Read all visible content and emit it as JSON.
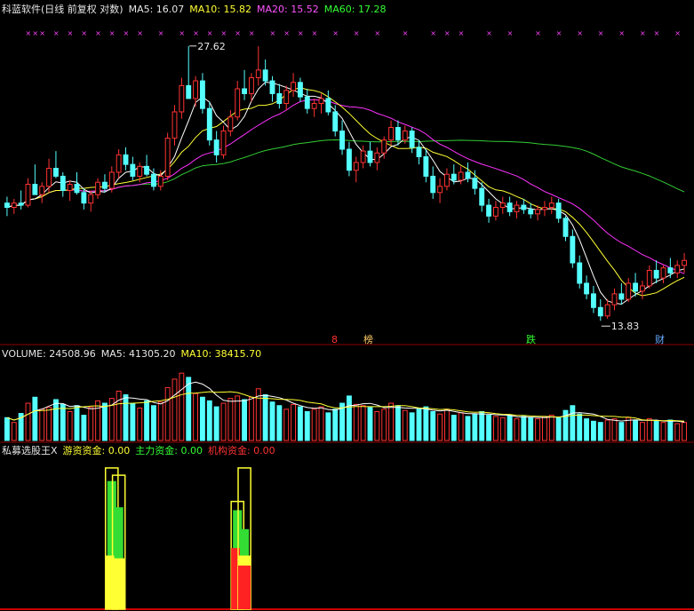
{
  "header_price": {
    "title": "科蓝软件(日线 前复权 对数)",
    "ma5": "MA5: 16.07",
    "ma10": "MA10: 15.82",
    "ma20": "MA20: 15.52",
    "ma60": "MA60: 17.28"
  },
  "header_volume": {
    "vol": "VOLUME: 24508.96",
    "ma5": "MA5: 41305.20",
    "ma10": "MA10: 38415.70"
  },
  "header_indicator": {
    "name": "私募选股王X",
    "youzi": "游资资金: 0.00",
    "zhuli": "主力资金: 0.00",
    "jigou": "机构资金: 0.00"
  },
  "annotations": {
    "high_label": "27.62",
    "low_label": "13.83",
    "tag1": "8",
    "tag2": "榜",
    "tag3": "跌",
    "tag4": "财"
  },
  "colors": {
    "up": "#ff3333",
    "down": "#55ffff",
    "ma5": "#ffffff",
    "ma10": "#ffff33",
    "ma20": "#ff33ff",
    "ma60": "#33cc33",
    "grid": "#8b0000"
  },
  "chart_data": {
    "type": "candlestick",
    "price_range": [
      13.5,
      29.0
    ],
    "candles": [
      [
        18.6,
        18.9,
        18.0,
        18.4
      ],
      [
        18.4,
        18.8,
        18.1,
        18.6
      ],
      [
        18.6,
        19.2,
        18.3,
        18.5
      ],
      [
        18.5,
        19.8,
        18.4,
        19.5
      ],
      [
        19.5,
        20.5,
        19.2,
        19.0
      ],
      [
        19.0,
        19.6,
        18.6,
        19.4
      ],
      [
        19.4,
        20.8,
        19.1,
        20.3
      ],
      [
        20.3,
        21.2,
        19.8,
        19.9
      ],
      [
        19.9,
        20.1,
        18.9,
        19.2
      ],
      [
        19.2,
        19.7,
        18.7,
        19.5
      ],
      [
        19.5,
        20.1,
        19.0,
        19.1
      ],
      [
        19.1,
        19.3,
        18.3,
        18.6
      ],
      [
        18.6,
        19.2,
        18.2,
        19.0
      ],
      [
        19.0,
        19.8,
        18.8,
        19.6
      ],
      [
        19.6,
        20.0,
        19.1,
        19.3
      ],
      [
        19.3,
        20.4,
        19.1,
        20.1
      ],
      [
        20.1,
        21.3,
        19.8,
        21.0
      ],
      [
        21.0,
        21.4,
        20.2,
        20.5
      ],
      [
        20.5,
        20.9,
        19.7,
        19.9
      ],
      [
        19.9,
        20.6,
        19.6,
        20.4
      ],
      [
        20.4,
        21.0,
        19.9,
        20.0
      ],
      [
        20.0,
        20.3,
        19.2,
        19.4
      ],
      [
        19.4,
        20.2,
        19.2,
        19.9
      ],
      [
        19.9,
        22.2,
        19.7,
        21.9
      ],
      [
        21.9,
        23.8,
        21.5,
        23.4
      ],
      [
        23.4,
        25.5,
        23.0,
        25.0
      ],
      [
        25.0,
        27.62,
        24.5,
        24.2
      ],
      [
        24.2,
        25.6,
        23.7,
        25.3
      ],
      [
        25.3,
        25.8,
        23.3,
        23.6
      ],
      [
        23.6,
        24.0,
        21.5,
        21.8
      ],
      [
        21.8,
        22.3,
        20.6,
        21.0
      ],
      [
        21.0,
        22.6,
        20.8,
        22.3
      ],
      [
        22.3,
        23.5,
        22.0,
        23.1
      ],
      [
        23.1,
        25.3,
        22.9,
        24.8
      ],
      [
        24.8,
        26.0,
        24.1,
        24.5
      ],
      [
        24.5,
        25.8,
        24.0,
        25.5
      ],
      [
        25.5,
        27.6,
        25.0,
        26.0
      ],
      [
        26.0,
        26.7,
        25.0,
        25.3
      ],
      [
        25.3,
        25.6,
        24.0,
        24.5
      ],
      [
        24.5,
        25.1,
        23.6,
        23.9
      ],
      [
        23.9,
        25.0,
        23.5,
        24.7
      ],
      [
        24.7,
        25.8,
        24.3,
        25.2
      ],
      [
        25.2,
        25.5,
        24.0,
        24.3
      ],
      [
        24.3,
        24.8,
        23.3,
        23.6
      ],
      [
        23.6,
        24.2,
        23.1,
        23.9
      ],
      [
        23.9,
        24.5,
        23.3,
        24.2
      ],
      [
        24.2,
        24.7,
        23.2,
        23.4
      ],
      [
        23.4,
        23.8,
        22.0,
        22.3
      ],
      [
        22.3,
        22.9,
        21.0,
        21.3
      ],
      [
        21.3,
        21.7,
        19.9,
        20.2
      ],
      [
        20.2,
        20.9,
        19.6,
        20.6
      ],
      [
        20.6,
        21.5,
        20.3,
        21.2
      ],
      [
        21.2,
        21.7,
        20.4,
        20.6
      ],
      [
        20.6,
        21.4,
        20.2,
        21.1
      ],
      [
        21.1,
        22.0,
        20.8,
        21.8
      ],
      [
        21.8,
        22.9,
        21.5,
        22.5
      ],
      [
        22.5,
        22.9,
        21.5,
        21.8
      ],
      [
        21.8,
        22.6,
        21.6,
        22.3
      ],
      [
        22.3,
        22.5,
        21.1,
        21.4
      ],
      [
        21.4,
        21.8,
        20.5,
        20.9
      ],
      [
        20.9,
        21.3,
        19.6,
        19.9
      ],
      [
        19.9,
        20.4,
        18.8,
        19.1
      ],
      [
        19.1,
        19.8,
        18.6,
        19.4
      ],
      [
        19.4,
        20.3,
        19.2,
        20.0
      ],
      [
        20.0,
        20.5,
        19.5,
        19.7
      ],
      [
        19.7,
        20.4,
        19.5,
        20.1
      ],
      [
        20.1,
        20.6,
        19.6,
        19.8
      ],
      [
        19.8,
        20.2,
        19.0,
        19.3
      ],
      [
        19.3,
        19.6,
        18.2,
        18.5
      ],
      [
        18.5,
        18.8,
        17.7,
        18.0
      ],
      [
        18.0,
        18.7,
        17.8,
        18.4
      ],
      [
        18.4,
        18.9,
        18.1,
        18.6
      ],
      [
        18.6,
        18.9,
        18.0,
        18.2
      ],
      [
        18.2,
        18.7,
        17.9,
        18.5
      ],
      [
        18.5,
        18.8,
        18.1,
        18.3
      ],
      [
        18.3,
        18.6,
        17.9,
        18.1
      ],
      [
        18.1,
        18.5,
        17.8,
        18.3
      ],
      [
        18.3,
        18.7,
        18.0,
        18.4
      ],
      [
        18.4,
        18.9,
        18.1,
        18.6
      ],
      [
        18.6,
        18.8,
        17.7,
        17.9
      ],
      [
        17.9,
        18.0,
        16.9,
        17.1
      ],
      [
        17.1,
        17.4,
        15.8,
        16.0
      ],
      [
        16.0,
        16.3,
        15.0,
        15.2
      ],
      [
        15.2,
        15.5,
        14.6,
        14.8
      ],
      [
        14.8,
        15.1,
        14.1,
        14.3
      ],
      [
        14.3,
        14.6,
        13.83,
        14.0
      ],
      [
        14.0,
        14.6,
        13.9,
        14.4
      ],
      [
        14.4,
        15.0,
        14.2,
        14.8
      ],
      [
        14.8,
        15.2,
        14.4,
        14.6
      ],
      [
        14.6,
        15.4,
        14.5,
        15.2
      ],
      [
        15.2,
        15.6,
        14.7,
        14.9
      ],
      [
        14.9,
        15.3,
        14.6,
        15.1
      ],
      [
        15.1,
        15.9,
        15.0,
        15.7
      ],
      [
        15.7,
        16.1,
        15.2,
        15.4
      ],
      [
        15.4,
        15.9,
        15.2,
        15.8
      ],
      [
        15.8,
        16.2,
        15.4,
        15.6
      ],
      [
        15.6,
        16.1,
        15.4,
        15.9
      ],
      [
        15.9,
        16.4,
        15.6,
        16.1
      ]
    ],
    "volume_range": [
      0,
      130000
    ],
    "volume": [
      38000,
      30000,
      45000,
      62000,
      72000,
      52000,
      55000,
      68000,
      60000,
      48000,
      58000,
      42000,
      55000,
      66000,
      62000,
      70000,
      82000,
      76000,
      62000,
      54000,
      66000,
      58000,
      64000,
      88000,
      102000,
      112000,
      105000,
      78000,
      72000,
      66000,
      56000,
      62000,
      70000,
      74000,
      68000,
      72000,
      86000,
      76000,
      64000,
      58000,
      52000,
      60000,
      56000,
      48000,
      52000,
      56000,
      46000,
      52000,
      62000,
      74000,
      60000,
      58000,
      55000,
      48000,
      52000,
      62000,
      58000,
      50000,
      46000,
      52000,
      56000,
      48000,
      44000,
      52000,
      42000,
      46000,
      40000,
      44000,
      48000,
      42000,
      40000,
      38000,
      42000,
      36000,
      40000,
      38000,
      36000,
      40000,
      42000,
      38000,
      50000,
      58000,
      44000,
      36000,
      32000,
      30000,
      34000,
      36000,
      30000,
      38000,
      34000,
      30000,
      36000,
      32000,
      30000,
      34000,
      28000,
      30000
    ],
    "indicator": {
      "name": "私募选股王X",
      "range": [
        0,
        100
      ],
      "spikes": [
        {
          "index": 15,
          "red": 0,
          "green": 88,
          "yellow": 97
        },
        {
          "index": 16,
          "red": 0,
          "green": 70,
          "yellow": 92
        },
        {
          "index": 33,
          "red": 42,
          "green": 68,
          "yellow": 74
        },
        {
          "index": 34,
          "red": 30,
          "green": 55,
          "yellow": 97
        }
      ]
    }
  }
}
